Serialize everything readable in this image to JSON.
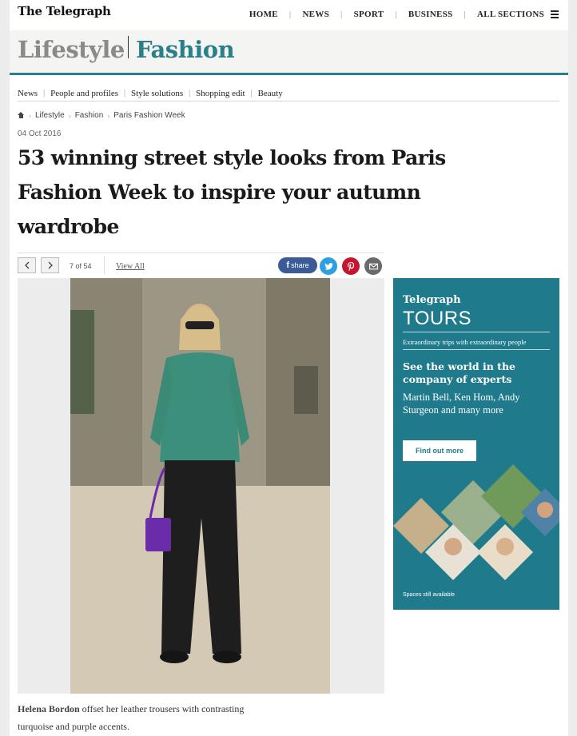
{
  "site": {
    "logo": "The Telegraph"
  },
  "topnav": {
    "items": [
      "HOME",
      "NEWS",
      "SPORT",
      "BUSINESS"
    ],
    "all_sections": "ALL SECTIONS"
  },
  "section": {
    "title": "Lifestyle",
    "subtitle": "Fashion"
  },
  "subnav": {
    "items": [
      "News",
      "People and profiles",
      "Style solutions",
      "Shopping edit",
      "Beauty"
    ]
  },
  "breadcrumb": {
    "items": [
      "Lifestyle",
      "Fashion",
      "Paris Fashion Week"
    ]
  },
  "article": {
    "date": "04 Oct 2016",
    "headline": "53 winning street style looks from Paris Fashion Week to inspire your autumn wardrobe"
  },
  "gallery": {
    "counter": "7 of 54",
    "view_all": "View All",
    "share_label": "share",
    "caption_name": "Helena Bordon",
    "caption_text": " offset her leather trousers with contrasting turquoise and purple accents."
  },
  "ad": {
    "brand": "Telegraph",
    "product": "TOURS",
    "tagline": "Extraordinary trips with extraordinary people",
    "headline": "See the world in the company of experts",
    "names": "Martin Bell, Ken Hom, Andy Sturgeon and many more",
    "cta": "Find out more",
    "footnote": "Spaces still available"
  },
  "colors": {
    "accent": "#2a7f8a",
    "ad_bg": "#1f7a8c",
    "facebook": "#3b5b96",
    "twitter": "#2e9fe0",
    "pinterest": "#c5162e"
  }
}
